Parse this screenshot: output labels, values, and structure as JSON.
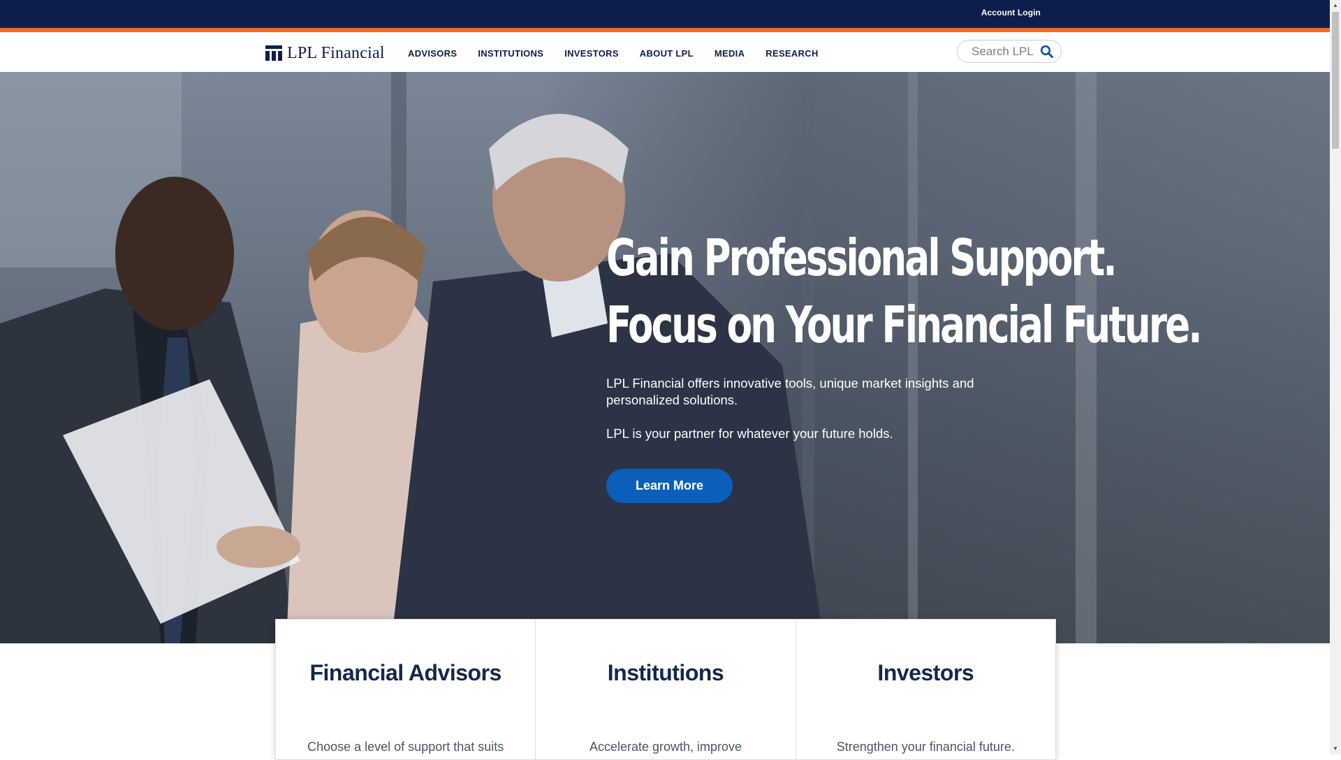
{
  "utility_bar": {
    "account_login": "Account Login"
  },
  "header": {
    "logo_text": "LPL Financial",
    "nav": [
      "ADVISORS",
      "INSTITUTIONS",
      "INVESTORS",
      "ABOUT LPL",
      "MEDIA",
      "RESEARCH"
    ],
    "search_placeholder": "Search LPL",
    "search_icon": "search-icon"
  },
  "hero": {
    "title_line1": "Gain Professional Support.",
    "title_line2": "Focus on Your Financial Future.",
    "paragraph1": "LPL Financial offers innovative tools, unique market insights and personalized solutions.",
    "paragraph2": "LPL is your partner for whatever your future holds.",
    "cta_label": "Learn More"
  },
  "cards": [
    {
      "title": "Financial Advisors",
      "text": "Choose a level of support that suits"
    },
    {
      "title": "Institutions",
      "text": "Accelerate growth, improve"
    },
    {
      "title": "Investors",
      "text": "Strengthen your financial future."
    }
  ],
  "colors": {
    "navy": "#0d1e4c",
    "orange_accent": "#f26b21",
    "cta_blue": "#0b5fb8"
  }
}
